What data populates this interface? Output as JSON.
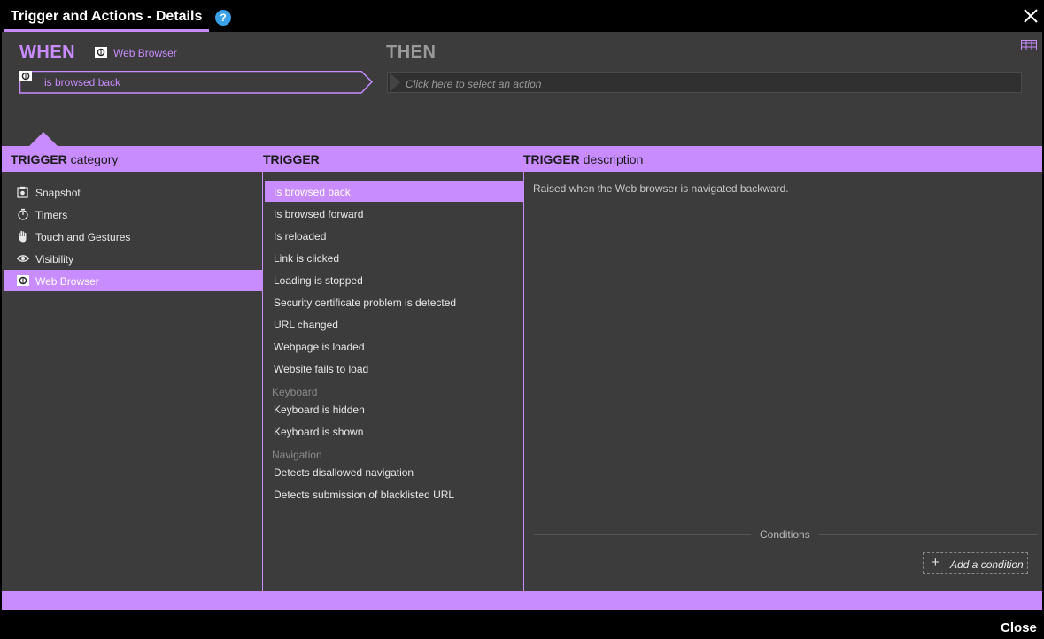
{
  "window": {
    "title": "Trigger and Actions - Details",
    "help_glyph": "?",
    "close_button": "Close"
  },
  "when": {
    "label": "WHEN",
    "source_icon": "web-browser-icon",
    "source_label": "Web Browser",
    "selected_trigger": "is browsed back"
  },
  "then": {
    "label": "THEN",
    "action_placeholder": "Click here to select an action"
  },
  "columns": {
    "category": {
      "bold": "TRIGGER",
      "rest": "category"
    },
    "trigger": {
      "bold": "TRIGGER",
      "rest": ""
    },
    "description": {
      "bold": "TRIGGER",
      "rest": "description"
    }
  },
  "categories": [
    {
      "label": "Snapshot",
      "icon": "snapshot-icon",
      "selected": false
    },
    {
      "label": "Timers",
      "icon": "timer-icon",
      "selected": false
    },
    {
      "label": "Touch and Gestures",
      "icon": "hand-icon",
      "selected": false
    },
    {
      "label": "Visibility",
      "icon": "eye-icon",
      "selected": false
    },
    {
      "label": "Web Browser",
      "icon": "web-browser-icon",
      "selected": true
    }
  ],
  "triggers": [
    {
      "label": "Is browsed back",
      "selected": true
    },
    {
      "label": "Is browsed forward",
      "selected": false
    },
    {
      "label": "Is reloaded",
      "selected": false
    },
    {
      "label": "Link is clicked",
      "selected": false
    },
    {
      "label": "Loading is stopped",
      "selected": false
    },
    {
      "label": "Security certificate problem is detected",
      "selected": false
    },
    {
      "label": "URL changed",
      "selected": false
    },
    {
      "label": "Webpage is loaded",
      "selected": false
    },
    {
      "label": "Website fails to load",
      "selected": false
    }
  ],
  "groups": [
    {
      "label": "Keyboard",
      "items": [
        "Keyboard is hidden",
        "Keyboard is shown"
      ]
    },
    {
      "label": "Navigation",
      "items": [
        "Detects disallowed navigation",
        "Detects submission of blacklisted URL"
      ]
    }
  ],
  "description": "Raised when the Web browser is navigated backward.",
  "conditions": {
    "label": "Conditions",
    "add_plus": "+",
    "add_label": "Add a condition"
  },
  "colors": {
    "accent": "#c88cff",
    "panel": "#3c3c3c",
    "help": "#3aa0e8"
  }
}
